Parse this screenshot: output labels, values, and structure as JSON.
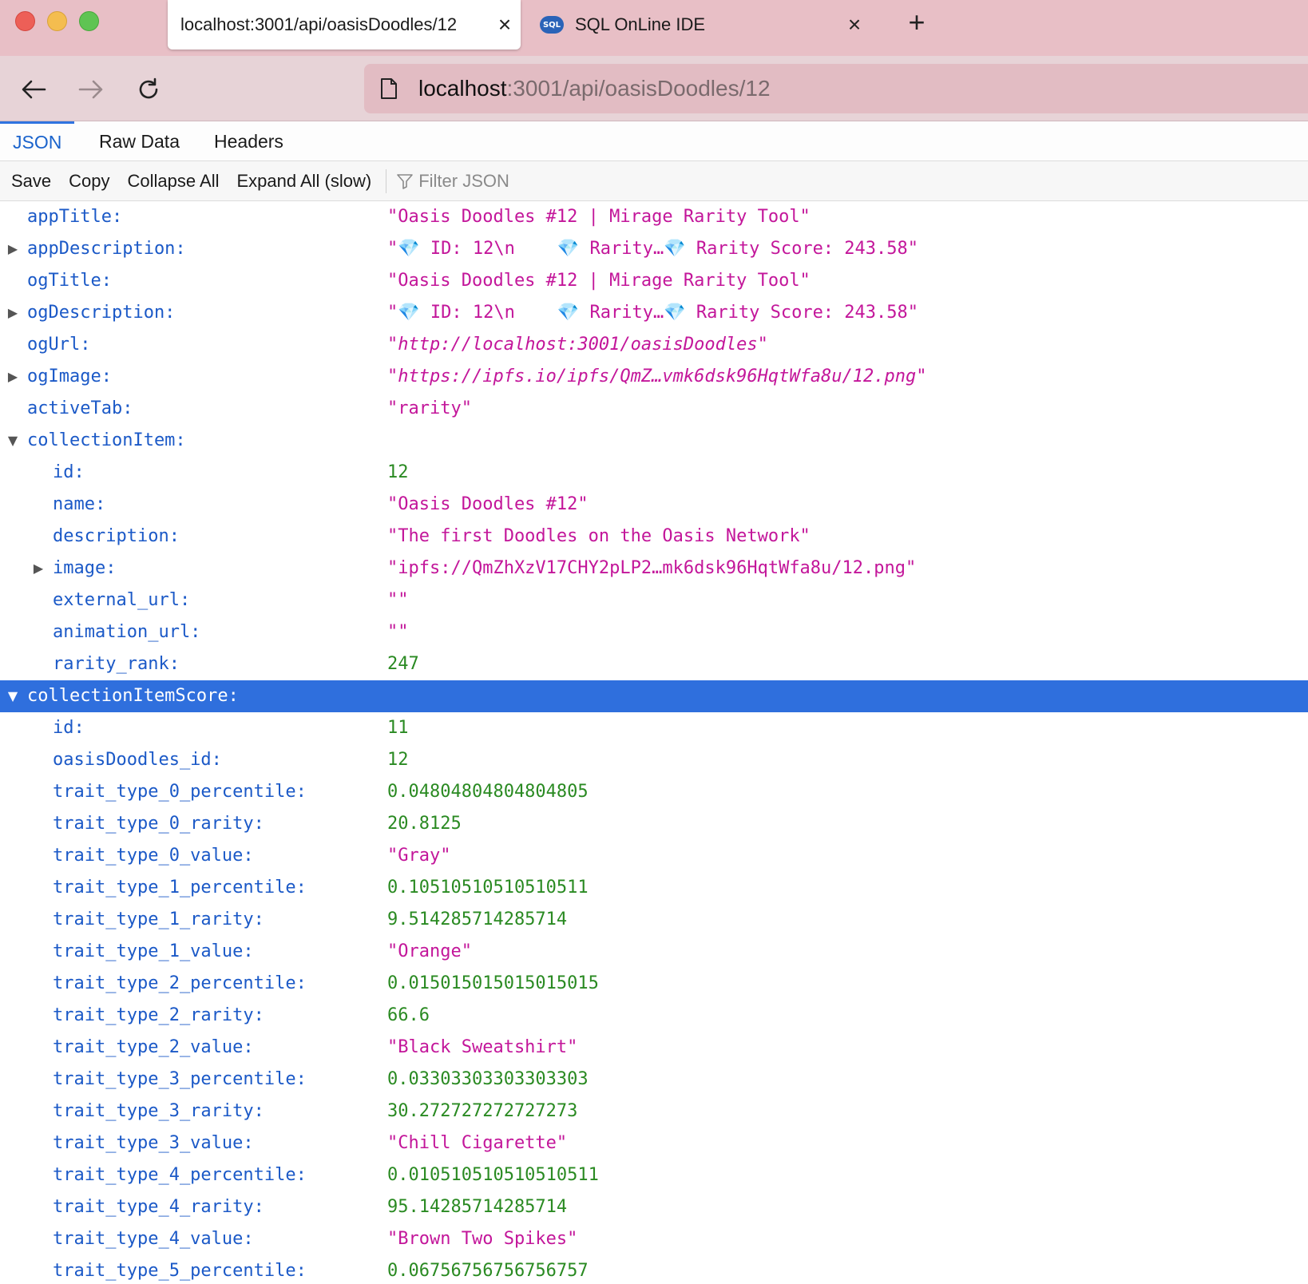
{
  "browser": {
    "active_tab_title": "localhost:3001/api/oasisDoodles/12",
    "inactive_tab_title": "SQL OnLine IDE",
    "inactive_tab_badge": "SQL",
    "url_host": "localhost",
    "url_path": ":3001/api/oasisDoodles/12"
  },
  "viewer": {
    "tabs": [
      "JSON",
      "Raw Data",
      "Headers"
    ],
    "toolbar": {
      "save": "Save",
      "copy": "Copy",
      "collapse_all": "Collapse All",
      "expand_all": "Expand All (slow)",
      "filter_placeholder": "Filter JSON"
    }
  },
  "json_rows": [
    {
      "key": "appTitle:",
      "value": "\"Oasis Doodles #12 | Mirage Rarity Tool\"",
      "type": "str"
    },
    {
      "key": "appDescription:",
      "value_parts": [
        "\"",
        "💎",
        " ID: 12\\n    ",
        "💎",
        " Rarity…",
        "💎",
        " Rarity Score: 243.58\""
      ],
      "type": "str"
    },
    {
      "key": "ogTitle:",
      "value": "\"Oasis Doodles #12 | Mirage Rarity Tool\"",
      "type": "str"
    },
    {
      "key": "ogDescription:",
      "value_parts": [
        "\"",
        "💎",
        " ID: 12\\n    ",
        "💎",
        " Rarity…",
        "💎",
        " Rarity Score: 243.58\""
      ],
      "type": "str"
    },
    {
      "key": "ogUrl:",
      "value": "http://localhost:3001/oasisDoodles",
      "type": "url"
    },
    {
      "key": "ogImage:",
      "value": "https://ipfs.io/ipfs/QmZ…vmk6dsk96HqtWfa8u/12.png",
      "type": "url"
    },
    {
      "key": "activeTab:",
      "value": "\"rarity\"",
      "type": "str"
    },
    {
      "key": "collectionItem:",
      "value": "",
      "type": "obj"
    },
    {
      "key": "id:",
      "value": "12",
      "type": "num"
    },
    {
      "key": "name:",
      "value": "\"Oasis Doodles #12\"",
      "type": "str"
    },
    {
      "key": "description:",
      "value": "\"The first Doodles on the Oasis Network\"",
      "type": "str"
    },
    {
      "key": "image:",
      "value": "\"ipfs://QmZhXzV17CHY2pLP2…mk6dsk96HqtWfa8u/12.png\"",
      "type": "str"
    },
    {
      "key": "external_url:",
      "value": "\"\"",
      "type": "str"
    },
    {
      "key": "animation_url:",
      "value": "\"\"",
      "type": "str"
    },
    {
      "key": "rarity_rank:",
      "value": "247",
      "type": "num"
    },
    {
      "key": "collectionItemScore:",
      "value": "",
      "type": "obj"
    },
    {
      "key": "id:",
      "value": "11",
      "type": "num"
    },
    {
      "key": "oasisDoodles_id:",
      "value": "12",
      "type": "num"
    },
    {
      "key": "trait_type_0_percentile:",
      "value": "0.04804804804804805",
      "type": "num"
    },
    {
      "key": "trait_type_0_rarity:",
      "value": "20.8125",
      "type": "num"
    },
    {
      "key": "trait_type_0_value:",
      "value": "\"Gray\"",
      "type": "str"
    },
    {
      "key": "trait_type_1_percentile:",
      "value": "0.10510510510510511",
      "type": "num"
    },
    {
      "key": "trait_type_1_rarity:",
      "value": "9.514285714285714",
      "type": "num"
    },
    {
      "key": "trait_type_1_value:",
      "value": "\"Orange\"",
      "type": "str"
    },
    {
      "key": "trait_type_2_percentile:",
      "value": "0.015015015015015015",
      "type": "num"
    },
    {
      "key": "trait_type_2_rarity:",
      "value": "66.6",
      "type": "num"
    },
    {
      "key": "trait_type_2_value:",
      "value": "\"Black Sweatshirt\"",
      "type": "str"
    },
    {
      "key": "trait_type_3_percentile:",
      "value": "0.03303303303303303",
      "type": "num"
    },
    {
      "key": "trait_type_3_rarity:",
      "value": "30.272727272727273",
      "type": "num"
    },
    {
      "key": "trait_type_3_value:",
      "value": "\"Chill Cigarette\"",
      "type": "str"
    },
    {
      "key": "trait_type_4_percentile:",
      "value": "0.010510510510510511",
      "type": "num"
    },
    {
      "key": "trait_type_4_rarity:",
      "value": "95.14285714285714",
      "type": "num"
    },
    {
      "key": "trait_type_4_value:",
      "value": "\"Brown Two Spikes\"",
      "type": "str"
    },
    {
      "key": "trait_type_5_percentile:",
      "value": "0.06756756756756757",
      "type": "num"
    }
  ]
}
